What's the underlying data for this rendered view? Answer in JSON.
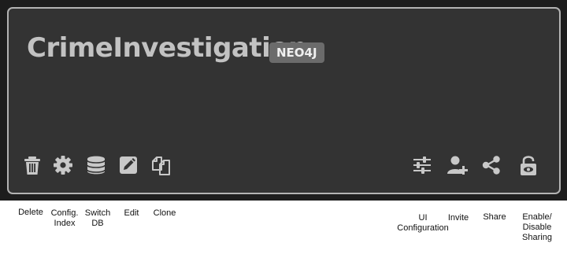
{
  "card": {
    "title": "CrimeInvestigation",
    "badge": "NEO4J"
  },
  "colors": {
    "card_background": "#333333",
    "card_border": "#b3b3b3",
    "icon": "#c8c8c8",
    "badge_background": "#6b6b6b"
  },
  "actions": {
    "delete": {
      "icon": "trash-icon",
      "caption": "Delete"
    },
    "config": {
      "icon": "gear-icon",
      "caption": "Config.\nIndex"
    },
    "switch_db": {
      "icon": "database-icon",
      "caption": "Switch\nDB"
    },
    "edit": {
      "icon": "pencil-square-icon",
      "caption": "Edit"
    },
    "clone": {
      "icon": "copy-icon",
      "caption": "Clone"
    },
    "ui_config": {
      "icon": "sliders-icon",
      "caption": "UI\nConfiguration"
    },
    "invite": {
      "icon": "user-plus-icon",
      "caption": "Invite"
    },
    "share": {
      "icon": "share-icon",
      "caption": "Share"
    },
    "sharing": {
      "icon": "lock-open-icon",
      "caption": "Enable/\nDisable\nSharing"
    }
  }
}
